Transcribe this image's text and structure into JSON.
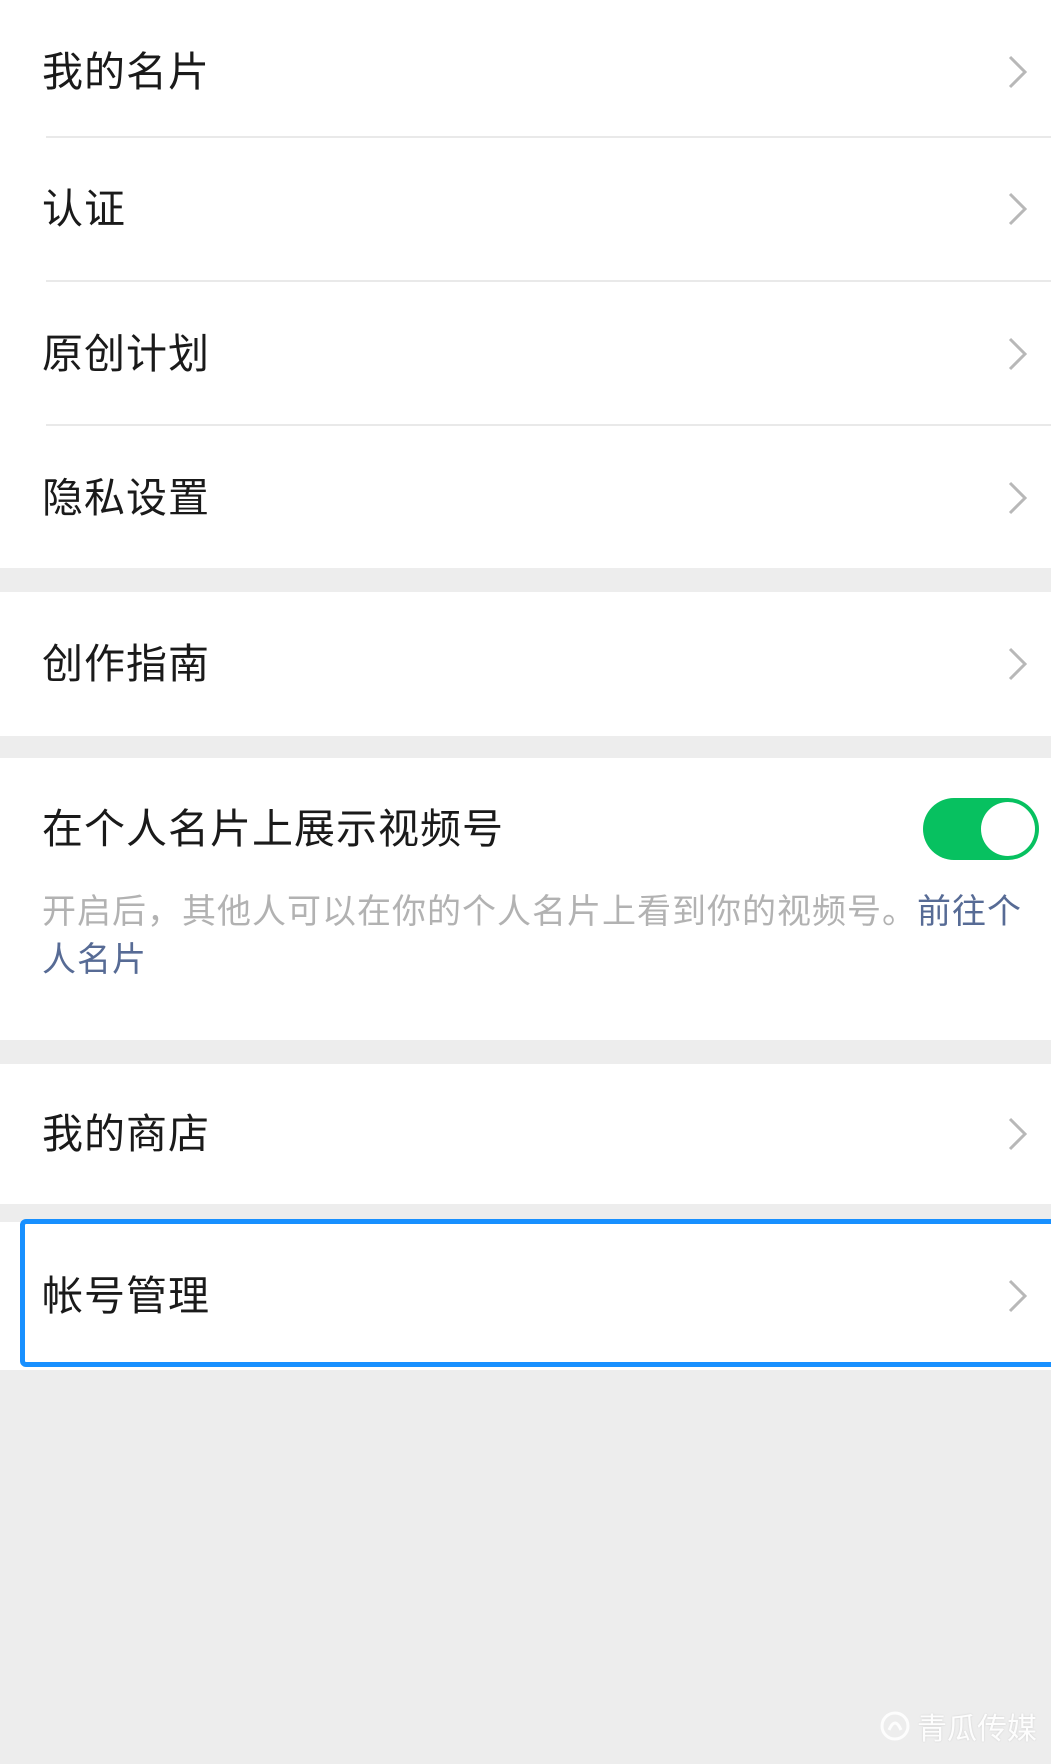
{
  "colors": {
    "background": "#ededed",
    "card": "#ffffff",
    "text_primary": "#1a1a1a",
    "text_secondary": "#b2b2b2",
    "link": "#576b95",
    "toggle_on": "#07c160",
    "highlight": "#1890ff"
  },
  "group1": {
    "items": [
      {
        "label": "我的名片",
        "icon": "chevron-right-icon"
      },
      {
        "label": "认证",
        "icon": "chevron-right-icon"
      },
      {
        "label": "原创计划",
        "icon": "chevron-right-icon"
      },
      {
        "label": "隐私设置",
        "icon": "chevron-right-icon"
      }
    ]
  },
  "group2": {
    "items": [
      {
        "label": "创作指南",
        "icon": "chevron-right-icon"
      }
    ]
  },
  "group3": {
    "title": "在个人名片上展示视频号",
    "toggle_on": true,
    "description": "开启后，其他人可以在你的个人名片上看到你的视频号。",
    "link_text": "前往个人名片"
  },
  "group4": {
    "items": [
      {
        "label": "我的商店",
        "icon": "chevron-right-icon"
      }
    ]
  },
  "group5": {
    "items": [
      {
        "label": "帐号管理",
        "icon": "chevron-right-icon",
        "highlighted": true
      }
    ]
  },
  "watermark": {
    "text": "青瓜传媒",
    "icon": "qinggua-logo-icon"
  }
}
